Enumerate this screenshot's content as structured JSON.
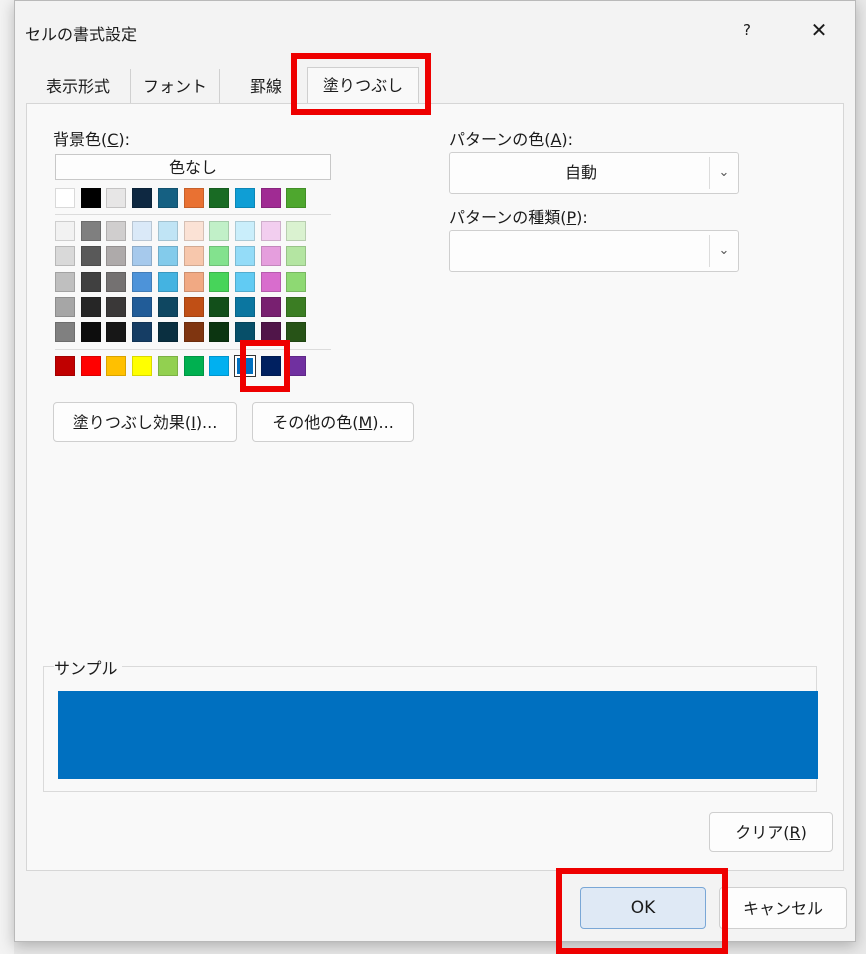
{
  "dialog": {
    "title": "セルの書式設定",
    "help": "?",
    "close": "✕"
  },
  "tabs": [
    {
      "label": "表示形式"
    },
    {
      "label": "フォント"
    },
    {
      "label": "罫線"
    },
    {
      "label": "塗りつぶし"
    }
  ],
  "fill": {
    "background_label_prefix": "背景色(",
    "background_label_key": "C",
    "background_label_suffix": "):",
    "no_color": "色なし",
    "fill_effects_prefix": "塗りつぶし効果(",
    "fill_effects_key": "I",
    "fill_effects_suffix": ")...",
    "more_colors_prefix": "その他の色(",
    "more_colors_key": "M",
    "more_colors_suffix": ")...",
    "selected_color": "#0070c0"
  },
  "pattern": {
    "color_label_prefix": "パターンの色(",
    "color_label_key": "A",
    "color_label_suffix": "):",
    "color_value": "自動",
    "style_label_prefix": "パターンの種類(",
    "style_label_key": "P",
    "style_label_suffix": "):",
    "style_value": ""
  },
  "sample": {
    "label": "サンプル",
    "color": "#0070c0"
  },
  "buttons": {
    "clear_prefix": "クリア(",
    "clear_key": "R",
    "clear_suffix": ")",
    "ok": "OK",
    "cancel": "キャンセル"
  },
  "palette": {
    "theme_top": [
      "#ffffff",
      "#000000",
      "#e7e6e6",
      "#0e2841",
      "#156082",
      "#e97132",
      "#196b24",
      "#0f9ed5",
      "#a02b93",
      "#4ea72e"
    ],
    "theme_shades": [
      [
        "#f2f2f2",
        "#7f7f7f",
        "#d0cece",
        "#dae9f8",
        "#c0e4f5",
        "#fbe2d5",
        "#c1f0c8",
        "#caeefb",
        "#f2ceef",
        "#daf2d0"
      ],
      [
        "#d9d9d9",
        "#595959",
        "#aeaaaa",
        "#a6c9ec",
        "#83cbeb",
        "#f7c7ac",
        "#83e28e",
        "#94dcf8",
        "#e59edd",
        "#b4e5a2"
      ],
      [
        "#bfbfbf",
        "#404040",
        "#747171",
        "#4d93d9",
        "#44b3e1",
        "#f1a983",
        "#47d45a",
        "#61cbf3",
        "#d86dcd",
        "#8ed973"
      ],
      [
        "#a6a6a6",
        "#262626",
        "#3a3838",
        "#215c98",
        "#0f4761",
        "#c04f15",
        "#124f1a",
        "#0b76a0",
        "#782070",
        "#3b7d23"
      ],
      [
        "#808080",
        "#0d0d0d",
        "#171717",
        "#153d64",
        "#0a2f40",
        "#7f3510",
        "#0c3511",
        "#074f69",
        "#501549",
        "#275317"
      ]
    ],
    "standard": [
      "#c00000",
      "#ff0000",
      "#ffc000",
      "#ffff00",
      "#92d050",
      "#00b050",
      "#00b0f0",
      "#0070c0",
      "#002060",
      "#7030a0"
    ]
  }
}
